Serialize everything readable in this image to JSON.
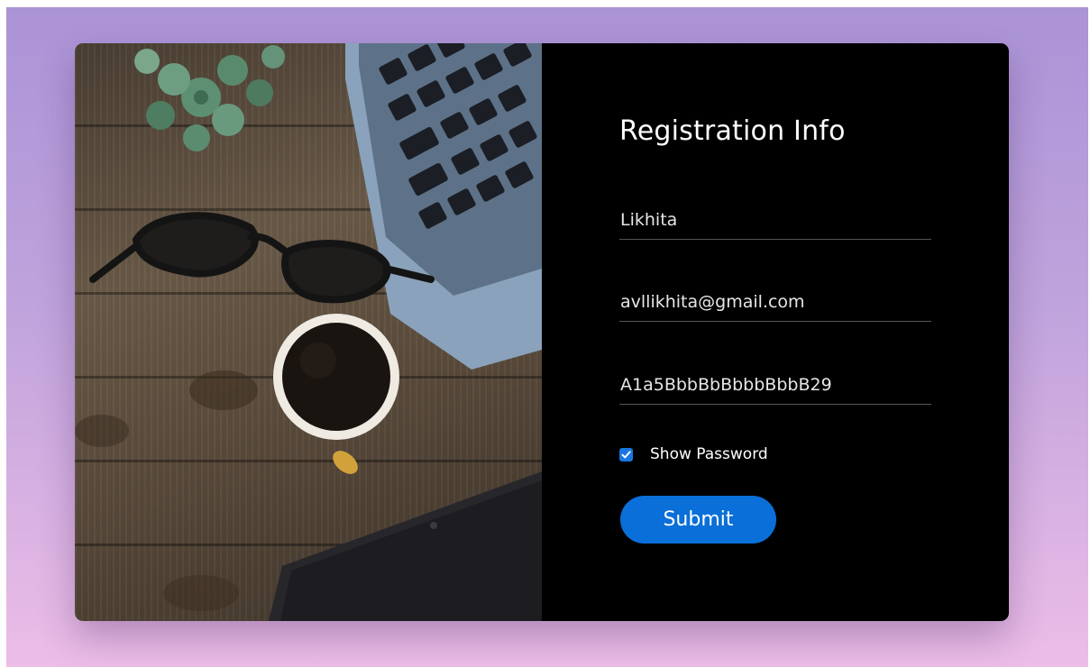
{
  "form": {
    "title": "Registration Info",
    "name_value": "Likhita",
    "email_value": "avllikhita@gmail.com",
    "password_value": "A1a5BbbBbBbbbBbbB29",
    "show_password_label": "Show Password",
    "show_password_checked": true,
    "submit_label": "Submit"
  },
  "colors": {
    "background_top": "#ab93d6",
    "background_bottom": "#ecbde7",
    "panel": "#000000",
    "accent": "#0a6fd8"
  },
  "icons": {
    "checkbox": "check-icon"
  }
}
